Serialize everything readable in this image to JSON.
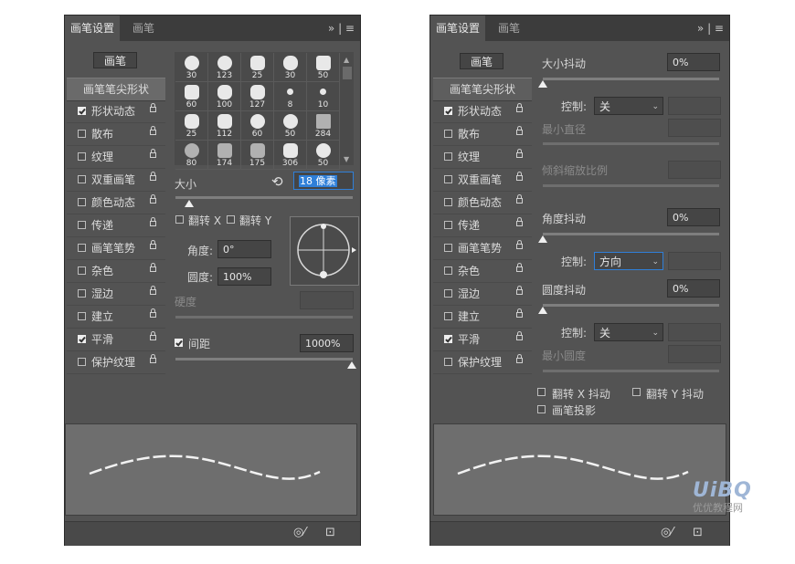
{
  "left_panel": {
    "tabs": [
      "画笔设置",
      "画笔"
    ],
    "tab_icons": "»  |  ≡",
    "brush_button": "画笔",
    "sidebar": {
      "tip_shape": "画笔笔尖形状",
      "items": [
        {
          "label": "形状动态",
          "checked": true
        },
        {
          "label": "散布",
          "checked": false
        },
        {
          "label": "纹理",
          "checked": false
        },
        {
          "label": "双重画笔",
          "checked": false
        },
        {
          "label": "颜色动态",
          "checked": false
        },
        {
          "label": "传递",
          "checked": false
        },
        {
          "label": "画笔笔势",
          "checked": false
        },
        {
          "label": "杂色",
          "checked": false
        },
        {
          "label": "湿边",
          "checked": false
        },
        {
          "label": "建立",
          "checked": false
        },
        {
          "label": "平滑",
          "checked": true
        },
        {
          "label": "保护纹理",
          "checked": false
        }
      ]
    },
    "presets": [
      "30",
      "123",
      "25",
      "30",
      "50",
      "60",
      "100",
      "127",
      "8",
      "10",
      "25",
      "112",
      "60",
      "50",
      "284",
      "80",
      "174",
      "175",
      "306",
      "50"
    ],
    "size_label": "大小",
    "size_value": "18 像素",
    "flip_x": "翻转 X",
    "flip_y": "翻转 Y",
    "angle_label": "角度:",
    "angle_value": "0°",
    "roundness_label": "圆度:",
    "roundness_value": "100%",
    "hardness_label": "硬度",
    "spacing_label": "间距",
    "spacing_value": "1000%",
    "spacing_checked": true
  },
  "right_panel": {
    "tabs": [
      "画笔设置",
      "画笔"
    ],
    "tab_icons": "»  |  ≡",
    "brush_button": "画笔",
    "sidebar": {
      "tip_shape": "画笔笔尖形状",
      "items": [
        {
          "label": "形状动态",
          "checked": true
        },
        {
          "label": "散布",
          "checked": false
        },
        {
          "label": "纹理",
          "checked": false
        },
        {
          "label": "双重画笔",
          "checked": false
        },
        {
          "label": "颜色动态",
          "checked": false
        },
        {
          "label": "传递",
          "checked": false
        },
        {
          "label": "画笔笔势",
          "checked": false
        },
        {
          "label": "杂色",
          "checked": false
        },
        {
          "label": "湿边",
          "checked": false
        },
        {
          "label": "建立",
          "checked": false
        },
        {
          "label": "平滑",
          "checked": true
        },
        {
          "label": "保护纹理",
          "checked": false
        }
      ]
    },
    "size_jitter_label": "大小抖动",
    "size_jitter_value": "0%",
    "control_label": "控制:",
    "control1_value": "关",
    "min_diameter_label": "最小直径",
    "tilt_scale_label": "倾斜缩放比例",
    "angle_jitter_label": "角度抖动",
    "angle_jitter_value": "0%",
    "control2_value": "方向",
    "roundness_jitter_label": "圆度抖动",
    "roundness_jitter_value": "0%",
    "control3_value": "关",
    "min_roundness_label": "最小圆度",
    "flip_x_jitter": "翻转 X 抖动",
    "flip_y_jitter": "翻转 Y 抖动",
    "brush_projection": "画笔投影"
  },
  "watermark": {
    "logo": "UiBQ",
    "text": "优优教程网"
  }
}
